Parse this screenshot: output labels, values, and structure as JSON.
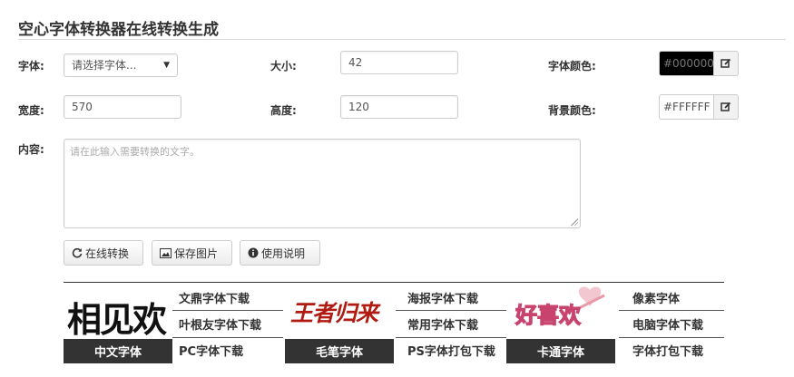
{
  "title": "空心字体转换器在线转换生成",
  "form": {
    "font_label": "字体:",
    "font_select": "请选择字体...",
    "size_label": "大小:",
    "size_value": "42",
    "font_color_label": "字体颜色:",
    "font_color_value": "#000000",
    "width_label": "宽度:",
    "width_value": "570",
    "height_label": "高度:",
    "height_value": "120",
    "bg_color_label": "背景颜色:",
    "bg_color_value": "#FFFFFF",
    "content_label": "内容:",
    "content_placeholder": "请在此输入需要转换的文字。"
  },
  "colors": {
    "font_swatch": "#000000",
    "bg_swatch": "#FFFFFF"
  },
  "buttons": {
    "convert": "在线转换",
    "save": "保存图片",
    "help": "使用说明"
  },
  "banner": {
    "groups": [
      {
        "image_text": "相见欢",
        "caption": "中文字体",
        "links": [
          "文鼎字体下载",
          "叶根友字体下载",
          "PC字体下载"
        ]
      },
      {
        "image_text": "王者归来",
        "caption": "毛笔字体",
        "links": [
          "海报字体下载",
          "常用字体下载",
          "PS字体打包下载"
        ]
      },
      {
        "image_text": "好喜欢",
        "caption": "卡通字体",
        "links": [
          "像素字体",
          "电脑字体下载",
          "字体打包下载"
        ]
      }
    ]
  }
}
